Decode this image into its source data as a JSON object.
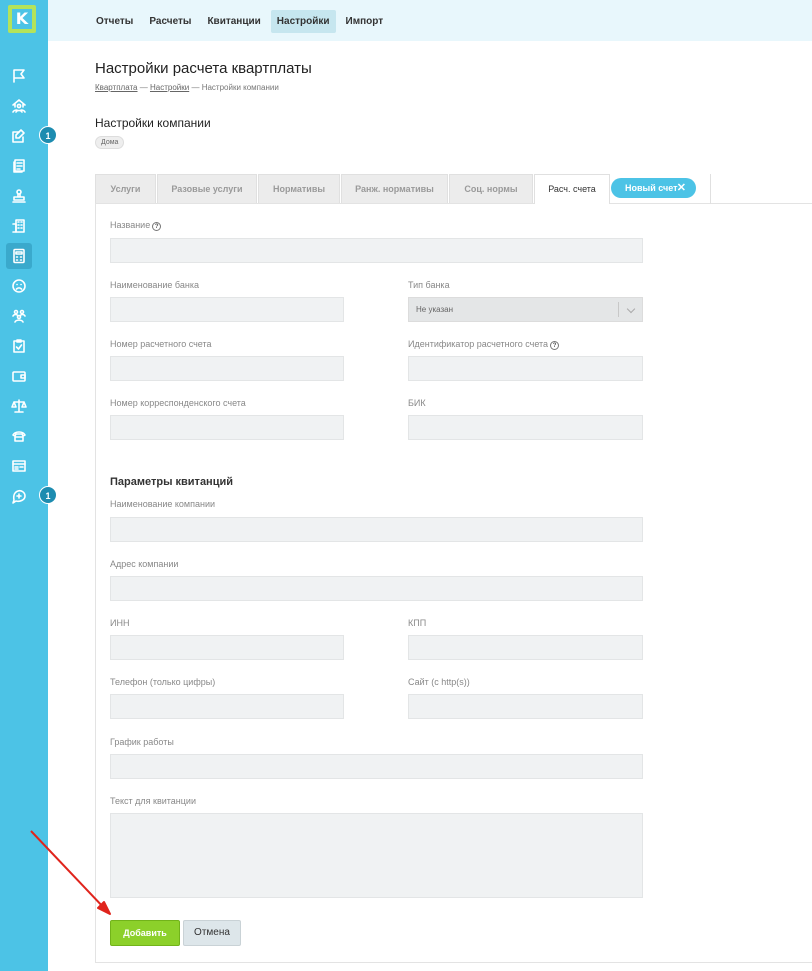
{
  "sidebar": {
    "logo_letter": "K",
    "icons": [
      "flag-icon",
      "house-people-icon",
      "edit-note-icon",
      "documents-icon",
      "stamp-icon",
      "building-icon",
      "calculator-icon",
      "sad-face-icon",
      "group-icon",
      "clipboard-check-icon",
      "wallet-icon",
      "scales-icon",
      "phone-icon",
      "card-icon",
      "chat-add-icon"
    ],
    "badges": [
      "1",
      "1"
    ]
  },
  "topnav": {
    "items": [
      "Отчеты",
      "Расчеты",
      "Квитанции",
      "Настройки",
      "Импорт"
    ]
  },
  "page": {
    "title": "Настройки расчета квартплаты",
    "breadcrumb": [
      "Квартплата",
      "Настройки",
      "Настройки компании"
    ],
    "section_title": "Настройки компании",
    "chip": "Дома"
  },
  "tabs": {
    "items": [
      "Услуги",
      "Разовые услуги",
      "Нормативы",
      "Ранж. нормативы",
      "Соц. нормы",
      "Расч. счета"
    ],
    "active": "Расч. счета",
    "new_pill": "Новый счет",
    "close_glyph": "✕"
  },
  "form": {
    "name_label": "Название",
    "help_glyph": "?",
    "bank_name_label": "Наименование банка",
    "bank_type_label": "Тип банка",
    "bank_type_value": "Не указан",
    "account_number_label": "Номер расчетного счета",
    "account_id_label": "Идентификатор расчетного счета",
    "corr_account_label": "Номер корреспонденского счета",
    "bik_label": "БИК",
    "receipt_params_title": "Параметры квитанций",
    "company_name_label": "Наименование компании",
    "company_address_label": "Адрес компании",
    "inn_label": "ИНН",
    "kpp_label": "КПП",
    "phone_label": "Телефон (только цифры)",
    "site_label": "Сайт (с http(s))",
    "schedule_label": "График работы",
    "receipt_text_label": "Текст для квитанции",
    "add_button": "Добавить",
    "cancel_button": "Отмена"
  },
  "colors": {
    "sidebar": "#4cc3e6",
    "accent_green": "#8cd02a",
    "annotation_arrow": "#e0241c"
  }
}
